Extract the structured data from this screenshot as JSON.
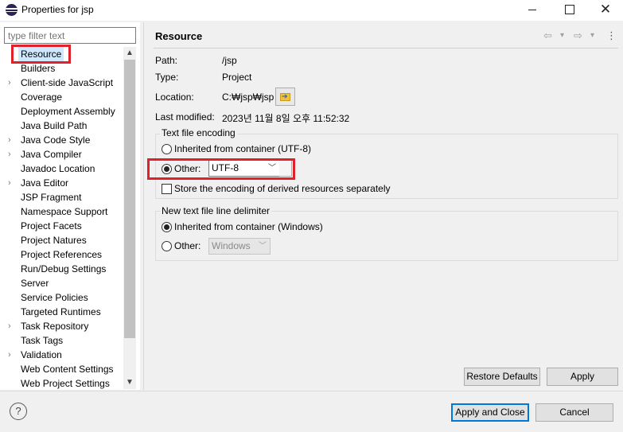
{
  "window": {
    "title": "Properties for jsp",
    "minimize_glyph": "",
    "maximize_glyph": "",
    "close_glyph": "✕"
  },
  "filter": {
    "placeholder": "type filter text"
  },
  "tree": {
    "items": [
      {
        "label": "Resource",
        "expandable": false,
        "selected": true
      },
      {
        "label": "Builders",
        "expandable": false
      },
      {
        "label": "Client-side JavaScript",
        "expandable": true
      },
      {
        "label": "Coverage",
        "expandable": false
      },
      {
        "label": "Deployment Assembly",
        "expandable": false
      },
      {
        "label": "Java Build Path",
        "expandable": false
      },
      {
        "label": "Java Code Style",
        "expandable": true
      },
      {
        "label": "Java Compiler",
        "expandable": true
      },
      {
        "label": "Javadoc Location",
        "expandable": false
      },
      {
        "label": "Java Editor",
        "expandable": true
      },
      {
        "label": "JSP Fragment",
        "expandable": false
      },
      {
        "label": "Namespace Support",
        "expandable": false
      },
      {
        "label": "Project Facets",
        "expandable": false
      },
      {
        "label": "Project Natures",
        "expandable": false
      },
      {
        "label": "Project References",
        "expandable": false
      },
      {
        "label": "Run/Debug Settings",
        "expandable": false
      },
      {
        "label": "Server",
        "expandable": false
      },
      {
        "label": "Service Policies",
        "expandable": false
      },
      {
        "label": "Targeted Runtimes",
        "expandable": false
      },
      {
        "label": "Task Repository",
        "expandable": true
      },
      {
        "label": "Task Tags",
        "expandable": false
      },
      {
        "label": "Validation",
        "expandable": true
      },
      {
        "label": "Web Content Settings",
        "expandable": false
      },
      {
        "label": "Web Project Settings",
        "expandable": false
      }
    ],
    "twisty_glyph": "›",
    "scroll_up_glyph": "▲",
    "scroll_down_glyph": "▼"
  },
  "page": {
    "title": "Resource",
    "nav": {
      "back": "⇦",
      "back_menu": "▾",
      "forward": "⇨",
      "forward_menu": "▾",
      "more": "⋮"
    },
    "path_label": "Path:",
    "path_value": "/jsp",
    "type_label": "Type:",
    "type_value": "Project",
    "location_label": "Location:",
    "location_value": "C:₩jsp₩jsp",
    "location_button_arrow": "➔",
    "modified_label": "Last modified:",
    "modified_value": "2023년 11월 8일 오후 11:52:32"
  },
  "encoding": {
    "group_title": "Text file encoding",
    "inherited_label": "Inherited from container (UTF-8)",
    "inherited_selected": false,
    "other_label": "Other:",
    "other_selected": true,
    "other_value": "UTF-8",
    "store_label": "Store the encoding of derived resources separately",
    "store_checked": false
  },
  "delimiter": {
    "group_title": "New text file line delimiter",
    "inherited_label": "Inherited from container (Windows)",
    "inherited_selected": true,
    "other_label": "Other:",
    "other_selected": false,
    "other_value": "Windows"
  },
  "combo_chevron": "﹀",
  "buttons": {
    "restore_defaults": "Restore Defaults",
    "apply": "Apply",
    "apply_and_close": "Apply and Close",
    "cancel": "Cancel",
    "help": "?"
  },
  "colors": {
    "highlight": "#e0202a",
    "selection": "#cde8ff",
    "default_button_border": "#0078d7"
  }
}
